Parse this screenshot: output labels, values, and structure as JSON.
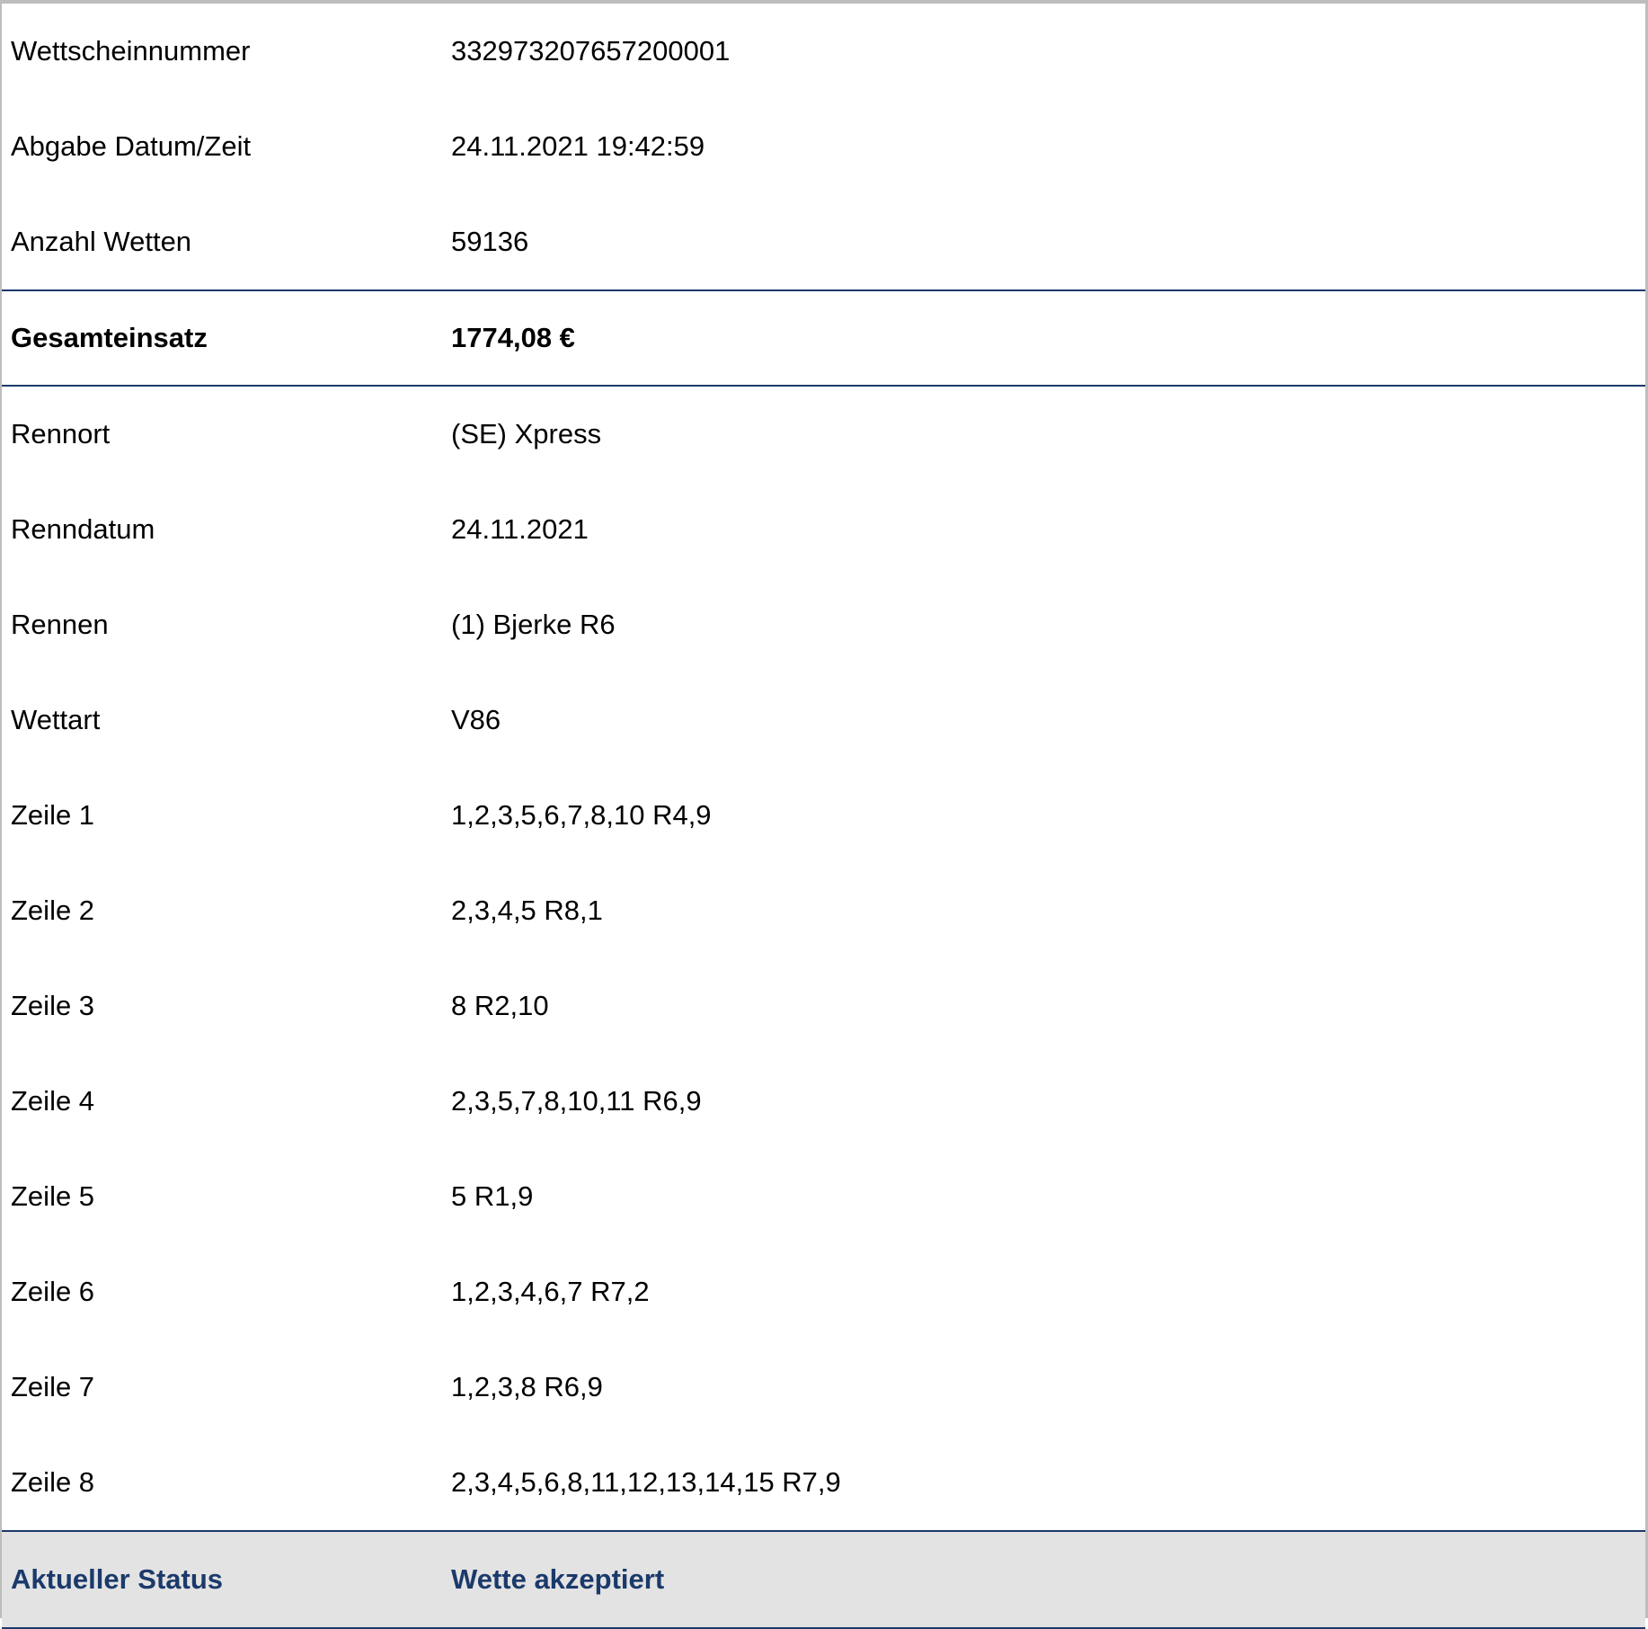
{
  "summary": {
    "rows": [
      {
        "label": "Wettscheinnummer",
        "value": "332973207657200001"
      },
      {
        "label": "Abgabe Datum/Zeit",
        "value": "24.11.2021 19:42:59"
      },
      {
        "label": "Anzahl Wetten",
        "value": "59136"
      }
    ]
  },
  "total": {
    "label": "Gesamteinsatz",
    "value": "1774,08 €"
  },
  "details": {
    "rows": [
      {
        "label": "Rennort",
        "value": "(SE) Xpress"
      },
      {
        "label": "Renndatum",
        "value": "24.11.2021"
      },
      {
        "label": "Rennen",
        "value": "(1) Bjerke R6"
      },
      {
        "label": "Wettart",
        "value": "V86"
      },
      {
        "label": "Zeile 1",
        "value": "1,2,3,5,6,7,8,10 R4,9"
      },
      {
        "label": "Zeile 2",
        "value": "2,3,4,5 R8,1"
      },
      {
        "label": "Zeile 3",
        "value": "8 R2,10"
      },
      {
        "label": "Zeile 4",
        "value": "2,3,5,7,8,10,11 R6,9"
      },
      {
        "label": "Zeile 5",
        "value": "5 R1,9"
      },
      {
        "label": "Zeile 6",
        "value": "1,2,3,4,6,7 R7,2"
      },
      {
        "label": "Zeile 7",
        "value": "1,2,3,8 R6,9"
      },
      {
        "label": "Zeile 8",
        "value": "2,3,4,5,6,8,11,12,13,14,15 R7,9"
      }
    ]
  },
  "status": {
    "label": "Aktueller Status",
    "value": "Wette akzeptiert"
  },
  "colors": {
    "accent": "#1b3a6b",
    "status_background": "#e3e3e3",
    "frame_border": "#bdbdbd"
  }
}
